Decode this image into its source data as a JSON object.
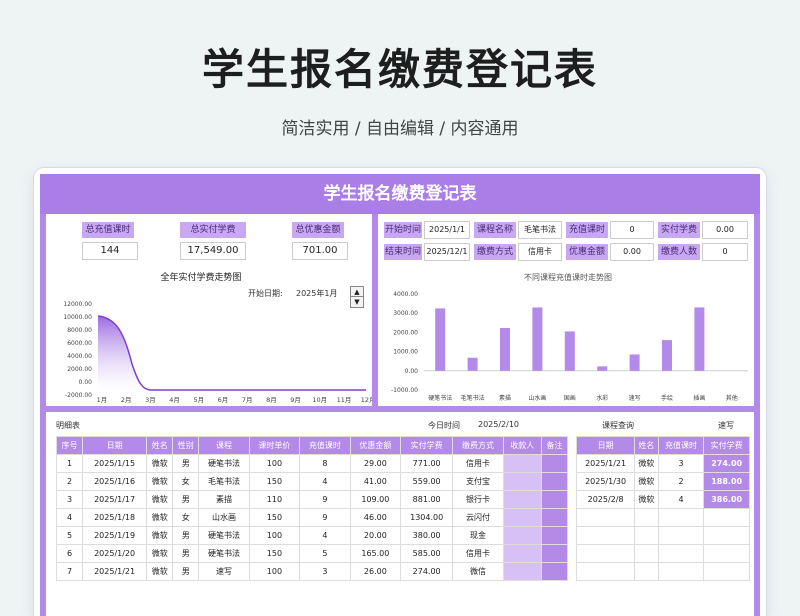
{
  "page": {
    "title": "学生报名缴费登记表",
    "subtitle": "简洁实用 / 自由编辑 / 内容通用"
  },
  "sheet": {
    "header": "学生报名缴费登记表"
  },
  "summary": [
    {
      "label": "总充值课时",
      "value": "144"
    },
    {
      "label": "总实付学费",
      "value": "17,549.00"
    },
    {
      "label": "总优惠金额",
      "value": "701.00"
    }
  ],
  "left_chart": {
    "title": "全年实付学费走势图",
    "start_label": "开始日期:",
    "start_value": "2025年1月",
    "y_ticks": [
      "12000.00",
      "10000.00",
      "8000.00",
      "6000.00",
      "4000.00",
      "2000.00",
      "0.00",
      "-2000.00"
    ],
    "x_ticks": [
      "1月",
      "2月",
      "3月",
      "4月",
      "5月",
      "6月",
      "7月",
      "8月",
      "9月",
      "10月",
      "11月",
      "12月"
    ]
  },
  "filters": {
    "start_time_label": "开始时间",
    "start_time": "2025/1/1",
    "course_label": "课程名称",
    "course": "毛笔书法",
    "hours_label": "充值课时",
    "hours": "0",
    "fee_label": "实付学费",
    "fee": "0.00",
    "end_time_label": "结束时间",
    "end_time": "2025/12/1",
    "pay_label": "缴费方式",
    "pay": "信用卡",
    "discount_label": "优惠金额",
    "discount": "0.00",
    "count_label": "缴费人数",
    "count": "0"
  },
  "chart_data": {
    "type": "bar",
    "title": "不同课程充值课时走势图",
    "categories": [
      "硬笔书法",
      "毛笔书法",
      "素描",
      "山水画",
      "国画",
      "水彩",
      "速写",
      "手绘",
      "插画",
      "其他"
    ],
    "values": [
      3250,
      680,
      2230,
      3300,
      2050,
      230,
      850,
      1600,
      3300,
      0
    ],
    "ylim": [
      -1000,
      4000
    ],
    "y_ticks": [
      "4000.00",
      "3000.00",
      "2000.00",
      "1000.00",
      "0.00",
      "-1000.00"
    ]
  },
  "detail": {
    "title": "明细表",
    "today_label": "今日时间",
    "today": "2025/2/10",
    "headers": [
      "序号",
      "日期",
      "姓名",
      "性别",
      "课程",
      "课时单价",
      "充值课时",
      "优惠金额",
      "实付学费",
      "缴费方式",
      "收款人",
      "备注"
    ],
    "rows": [
      [
        "1",
        "2025/1/15",
        "微软",
        "男",
        "硬笔书法",
        "100",
        "8",
        "29.00",
        "771.00",
        "信用卡",
        "",
        ""
      ],
      [
        "2",
        "2025/1/16",
        "微软",
        "女",
        "毛笔书法",
        "150",
        "4",
        "41.00",
        "559.00",
        "支付宝",
        "",
        ""
      ],
      [
        "3",
        "2025/1/17",
        "微软",
        "男",
        "素描",
        "110",
        "9",
        "109.00",
        "881.00",
        "银行卡",
        "",
        ""
      ],
      [
        "4",
        "2025/1/18",
        "微软",
        "女",
        "山水画",
        "150",
        "9",
        "46.00",
        "1304.00",
        "云闪付",
        "",
        ""
      ],
      [
        "5",
        "2025/1/19",
        "微软",
        "男",
        "硬笔书法",
        "100",
        "4",
        "20.00",
        "380.00",
        "现金",
        "",
        ""
      ],
      [
        "6",
        "2025/1/20",
        "微软",
        "男",
        "硬笔书法",
        "150",
        "5",
        "165.00",
        "585.00",
        "信用卡",
        "",
        ""
      ],
      [
        "7",
        "2025/1/21",
        "微软",
        "男",
        "速写",
        "100",
        "3",
        "26.00",
        "274.00",
        "微信",
        "",
        ""
      ]
    ]
  },
  "query": {
    "title": "课程查询",
    "course": "速写",
    "headers": [
      "日期",
      "姓名",
      "充值课时",
      "实付学费"
    ],
    "rows": [
      [
        "2025/1/21",
        "微软",
        "3",
        "274.00"
      ],
      [
        "2025/1/30",
        "微软",
        "2",
        "188.00"
      ],
      [
        "2025/2/8",
        "微软",
        "4",
        "386.00"
      ]
    ]
  }
}
